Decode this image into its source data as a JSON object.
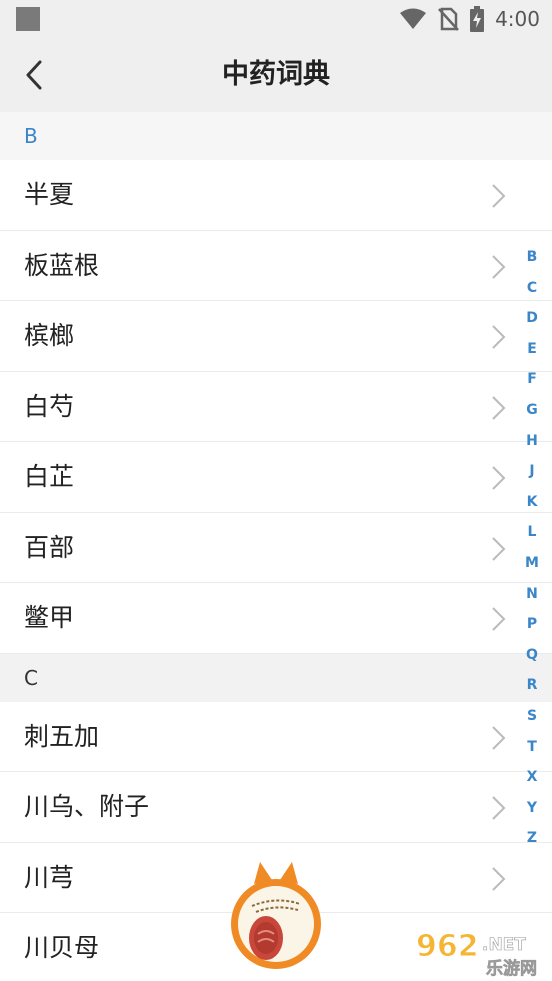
{
  "status_bar": {
    "time": "4:00",
    "icons": [
      "app-notification-icon",
      "wifi-icon",
      "no-sim-icon",
      "battery-charging-icon"
    ]
  },
  "header": {
    "title": "中药词典",
    "back_icon": "chevron-left-icon"
  },
  "sections": [
    {
      "letter": "B",
      "items": [
        "半夏",
        "板蓝根",
        "槟榔",
        "白芍",
        "白芷",
        "百部",
        "鳖甲"
      ]
    },
    {
      "letter": "C",
      "items": [
        "刺五加",
        "川乌、附子",
        "川芎",
        "川贝母"
      ]
    }
  ],
  "alphabet_index": [
    "B",
    "C",
    "D",
    "E",
    "F",
    "G",
    "H",
    "J",
    "K",
    "L",
    "M",
    "N",
    "P",
    "Q",
    "R",
    "S",
    "T",
    "X",
    "Y",
    "Z"
  ],
  "watermark": {
    "number": "962",
    "suffix": ".NET",
    "subtitle": "乐游网"
  },
  "colors": {
    "accent": "#3a86c8",
    "background": "#f2f2f2",
    "row_background": "#ffffff",
    "mascot_orange": "#f08a24"
  }
}
